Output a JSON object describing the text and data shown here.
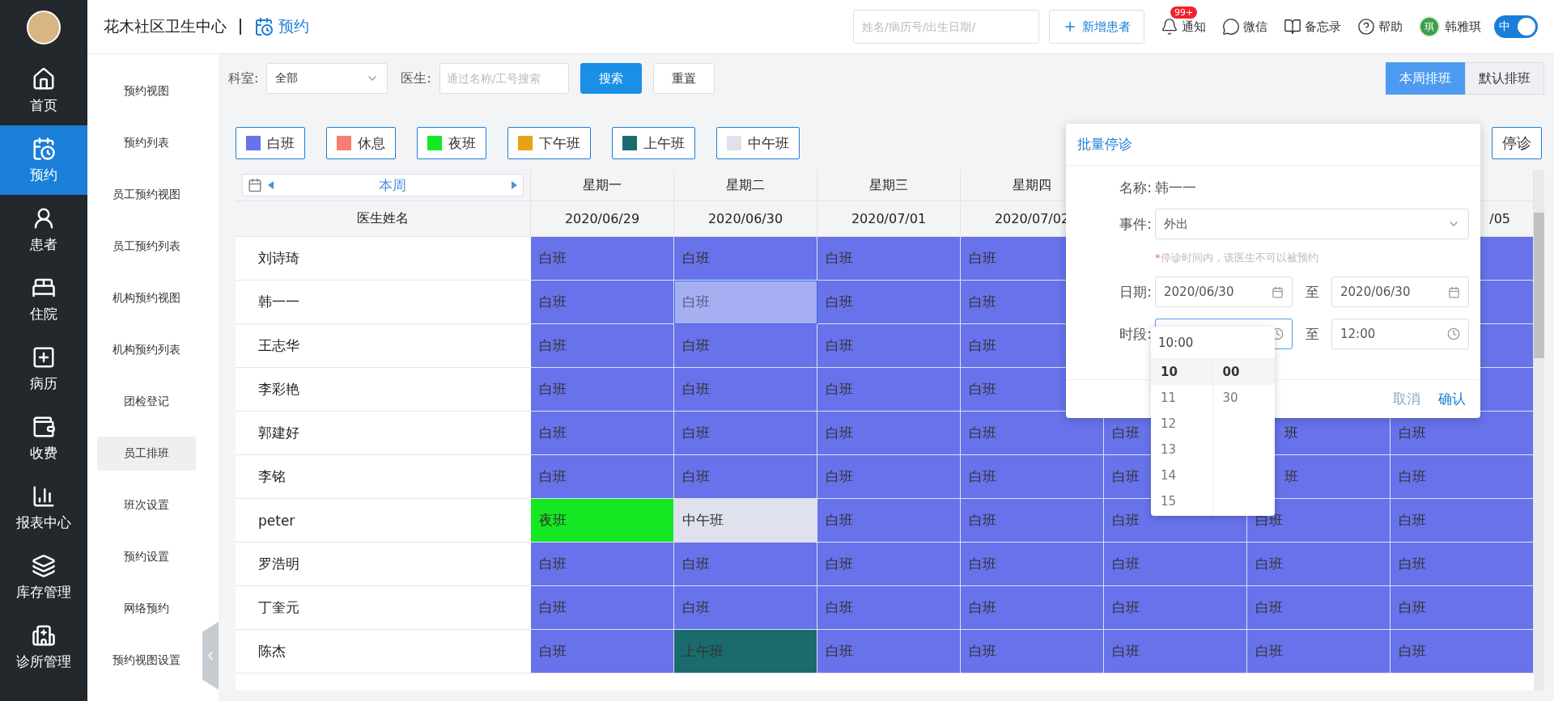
{
  "header": {
    "org": "花木社区卫生中心",
    "module": "预约",
    "search": {
      "placeholder": "姓名/病历号/出生日期/"
    },
    "add_button": "新增患者",
    "tools": [
      {
        "kind": "bell",
        "label": "通知",
        "badge": "99+"
      },
      {
        "kind": "chat",
        "label": "微信"
      },
      {
        "kind": "book",
        "label": "备忘录"
      },
      {
        "kind": "help",
        "label": "帮助"
      }
    ],
    "user": {
      "initial": "琪",
      "name": "韩雅琪"
    },
    "lang_toggle": {
      "label": "中",
      "on": true
    }
  },
  "nav": [
    {
      "kind": "home",
      "label": "首页",
      "selected": false
    },
    {
      "kind": "calendar",
      "label": "预约",
      "selected": true
    },
    {
      "kind": "user",
      "label": "患者",
      "selected": false
    },
    {
      "kind": "bed",
      "label": "住院",
      "selected": false
    },
    {
      "kind": "record",
      "label": "病历",
      "selected": false
    },
    {
      "kind": "money",
      "label": "收费",
      "selected": false
    },
    {
      "kind": "chart",
      "label": "报表中心",
      "selected": false
    },
    {
      "kind": "layers",
      "label": "库存管理",
      "selected": false
    },
    {
      "kind": "clinic",
      "label": "诊所管理",
      "selected": false
    }
  ],
  "submenu": [
    {
      "label": "预约视图",
      "selected": false
    },
    {
      "label": "预约列表",
      "selected": false
    },
    {
      "label": "员工预约视图",
      "selected": false
    },
    {
      "label": "员工预约列表",
      "selected": false
    },
    {
      "label": "机构预约视图",
      "selected": false
    },
    {
      "label": "机构预约列表",
      "selected": false
    },
    {
      "label": "团检登记",
      "selected": false
    },
    {
      "label": "员工排班",
      "selected": true
    },
    {
      "label": "班次设置",
      "selected": false
    },
    {
      "label": "预约设置",
      "selected": false
    },
    {
      "label": "网络预约",
      "selected": false
    },
    {
      "label": "预约视图设置",
      "selected": false
    }
  ],
  "filters": {
    "department_label": "科室:",
    "department_value": "全部",
    "doctor_label": "医生:",
    "doctor_placeholder": "通过名称/工号搜索",
    "search_button": "搜索",
    "reset_button": "重置"
  },
  "view_tabs": [
    {
      "label": "本周排班",
      "selected": true
    },
    {
      "label": "默认排班",
      "selected": false
    }
  ],
  "legend": [
    {
      "label": "白班",
      "color": "#6872ea"
    },
    {
      "label": "休息",
      "color": "#f87d72"
    },
    {
      "label": "夜班",
      "color": "#13e823"
    },
    {
      "label": "下午班",
      "color": "#e8a314"
    },
    {
      "label": "上午班",
      "color": "#1b6a6e"
    },
    {
      "label": "中午班",
      "color": "#dfe1ec"
    }
  ],
  "stop_button": "停诊",
  "table": {
    "week_label": "本周",
    "name_header": "医生姓名",
    "days": [
      {
        "weekday": "星期一",
        "date": "2020/06/29"
      },
      {
        "weekday": "星期二",
        "date": "2020/06/30"
      },
      {
        "weekday": "星期三",
        "date": "2020/07/01"
      },
      {
        "weekday": "星期四",
        "date": "2020/07/02"
      }
    ],
    "last_date_tail": "/05",
    "rows": [
      {
        "name": "刘诗琦",
        "cells": [
          {
            "text": "白班",
            "color": "#6872ea",
            "selected": false
          },
          {
            "text": "白班",
            "color": "#6872ea",
            "selected": false
          },
          {
            "text": "白班",
            "color": "#6872ea",
            "selected": false
          },
          {
            "text": "白班",
            "color": "#6872ea",
            "selected": false
          }
        ]
      },
      {
        "name": "韩一一",
        "cells": [
          {
            "text": "白班",
            "color": "#6872ea",
            "selected": false
          },
          {
            "text": "白班",
            "color": "#a8aef2",
            "selected": true
          },
          {
            "text": "白班",
            "color": "#6872ea",
            "selected": false
          },
          {
            "text": "白班",
            "color": "#6872ea",
            "selected": false
          }
        ]
      },
      {
        "name": "王志华",
        "cells": [
          {
            "text": "白班",
            "color": "#6872ea",
            "selected": false
          },
          {
            "text": "白班",
            "color": "#6872ea",
            "selected": false
          },
          {
            "text": "白班",
            "color": "#6872ea",
            "selected": false
          },
          {
            "text": "白班",
            "color": "#6872ea",
            "selected": false
          }
        ]
      },
      {
        "name": "李彩艳",
        "cells": [
          {
            "text": "白班",
            "color": "#6872ea",
            "selected": false
          },
          {
            "text": "白班",
            "color": "#6872ea",
            "selected": false
          },
          {
            "text": "白班",
            "color": "#6872ea",
            "selected": false
          },
          {
            "text": "白班",
            "color": "#6872ea",
            "selected": false
          }
        ]
      },
      {
        "name": "郭建好",
        "cells": [
          {
            "text": "白班",
            "color": "#6872ea",
            "selected": false
          },
          {
            "text": "白班",
            "color": "#6872ea",
            "selected": false
          },
          {
            "text": "白班",
            "color": "#6872ea",
            "selected": false
          },
          {
            "text": "白班",
            "color": "#6872ea",
            "selected": false
          },
          {
            "text": "白班",
            "color": "#6872ea",
            "selected": false
          },
          {
            "text": "班",
            "color": "#6872ea",
            "selected": false,
            "covered": true
          },
          {
            "text": "白班",
            "color": "#6872ea",
            "selected": false
          }
        ]
      },
      {
        "name": "李铭",
        "cells": [
          {
            "text": "白班",
            "color": "#6872ea",
            "selected": false
          },
          {
            "text": "白班",
            "color": "#6872ea",
            "selected": false
          },
          {
            "text": "白班",
            "color": "#6872ea",
            "selected": false
          },
          {
            "text": "白班",
            "color": "#6872ea",
            "selected": false
          },
          {
            "text": "白班",
            "color": "#6872ea",
            "selected": false
          },
          {
            "text": "班",
            "color": "#6872ea",
            "selected": false,
            "covered": true
          },
          {
            "text": "白班",
            "color": "#6872ea",
            "selected": false
          }
        ]
      },
      {
        "name": "peter",
        "cells": [
          {
            "text": "夜班",
            "color": "#13e823",
            "selected": false
          },
          {
            "text": "中午班",
            "color": "#dfe1ec",
            "selected": false
          },
          {
            "text": "白班",
            "color": "#6872ea",
            "selected": false
          },
          {
            "text": "白班",
            "color": "#6872ea",
            "selected": false
          },
          {
            "text": "白班",
            "color": "#6872ea",
            "selected": false
          },
          {
            "text": "白班",
            "color": "#6872ea",
            "selected": false
          },
          {
            "text": "白班",
            "color": "#6872ea",
            "selected": false
          }
        ]
      },
      {
        "name": "罗浩明",
        "cells": [
          {
            "text": "白班",
            "color": "#6872ea",
            "selected": false
          },
          {
            "text": "白班",
            "color": "#6872ea",
            "selected": false
          },
          {
            "text": "白班",
            "color": "#6872ea",
            "selected": false
          },
          {
            "text": "白班",
            "color": "#6872ea",
            "selected": false
          },
          {
            "text": "白班",
            "color": "#6872ea",
            "selected": false
          },
          {
            "text": "白班",
            "color": "#6872ea",
            "selected": false
          },
          {
            "text": "白班",
            "color": "#6872ea",
            "selected": false
          }
        ]
      },
      {
        "name": "丁奎元",
        "cells": [
          {
            "text": "白班",
            "color": "#6872ea",
            "selected": false
          },
          {
            "text": "白班",
            "color": "#6872ea",
            "selected": false
          },
          {
            "text": "白班",
            "color": "#6872ea",
            "selected": false
          },
          {
            "text": "白班",
            "color": "#6872ea",
            "selected": false
          },
          {
            "text": "白班",
            "color": "#6872ea",
            "selected": false
          },
          {
            "text": "白班",
            "color": "#6872ea",
            "selected": false
          },
          {
            "text": "白班",
            "color": "#6872ea",
            "selected": false
          }
        ]
      },
      {
        "name": "陈杰",
        "cells": [
          {
            "text": "白班",
            "color": "#6872ea",
            "selected": false
          },
          {
            "text": "上午班",
            "color": "#1b6a6e",
            "selected": false
          },
          {
            "text": "白班",
            "color": "#6872ea",
            "selected": false
          },
          {
            "text": "白班",
            "color": "#6872ea",
            "selected": false
          },
          {
            "text": "白班",
            "color": "#6872ea",
            "selected": false
          },
          {
            "text": "白班",
            "color": "#6872ea",
            "selected": false
          },
          {
            "text": "白班",
            "color": "#6872ea",
            "selected": false
          }
        ]
      }
    ]
  },
  "popup": {
    "title": "批量停诊",
    "name_label": "名称:",
    "name_value": "韩一一",
    "event_label": "事件:",
    "event_value": "外出",
    "note_mark": "*",
    "note": "停诊时间内，该医生不可以被预约",
    "date_label": "日期:",
    "date_from": "2020/06/30",
    "date_to": "2020/06/30",
    "range_sep": "至",
    "time_label": "时段:",
    "time_from": "10:00",
    "time_to": "12:00",
    "time_sep": "至",
    "cancel": "取消",
    "confirm": "确认",
    "time_picker": {
      "hours": [
        {
          "label": "10",
          "selected": true
        },
        {
          "label": "11",
          "selected": false
        },
        {
          "label": "12",
          "selected": false
        },
        {
          "label": "13",
          "selected": false
        },
        {
          "label": "14",
          "selected": false
        },
        {
          "label": "15",
          "selected": false
        }
      ],
      "minutes": [
        {
          "label": "00",
          "selected": true
        },
        {
          "label": "30",
          "selected": false
        }
      ]
    }
  }
}
